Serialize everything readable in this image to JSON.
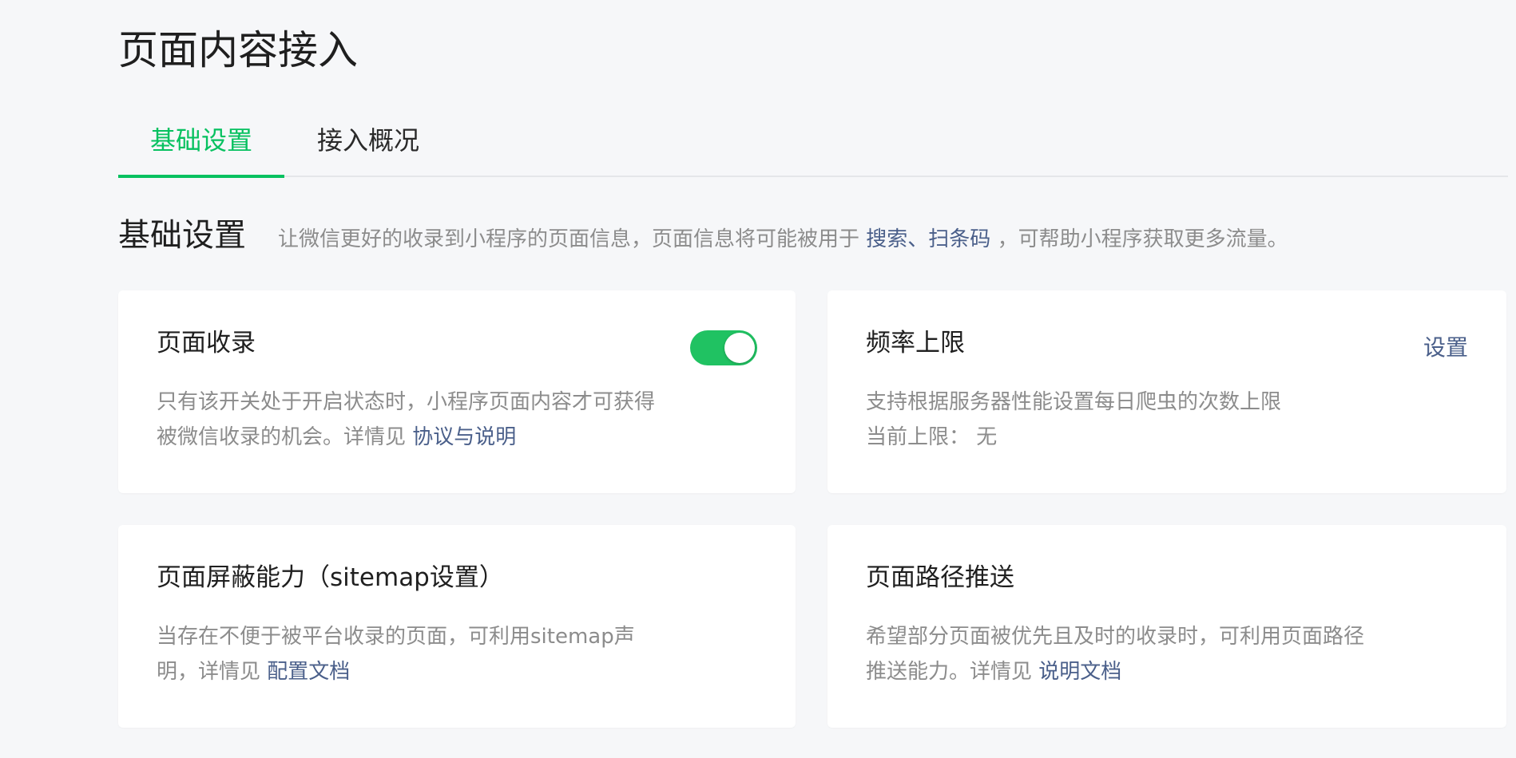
{
  "page": {
    "title": "页面内容接入"
  },
  "tabs": [
    {
      "label": "基础设置",
      "active": true
    },
    {
      "label": "接入概况",
      "active": false
    }
  ],
  "section": {
    "title": "基础设置",
    "desc_prefix": "让微信更好的收录到小程序的页面信息，页面信息将可能被用于",
    "desc_link": "搜索、扫条码",
    "desc_suffix": "，可帮助小程序获取更多流量。"
  },
  "cards": {
    "page_index": {
      "title": "页面收录",
      "toggle_on": true,
      "desc_line1": "只有该开关处于开启状态时，小程序页面内容才可获得",
      "desc_line2": "被微信收录的机会。详情见",
      "link": "协议与说明"
    },
    "rate_limit": {
      "title": "频率上限",
      "action": "设置",
      "desc_line1": "支持根据服务器性能设置每日爬虫的次数上限",
      "limit_label": "当前上限：",
      "limit_value": "无"
    },
    "sitemap": {
      "title": "页面屏蔽能力（sitemap设置）",
      "desc_line1": "当存在不便于被平台收录的页面，可利用sitemap声",
      "desc_line2": "明，详情见",
      "link": "配置文档"
    },
    "path_push": {
      "title": "页面路径推送",
      "desc_line1": "希望部分页面被优先且及时的收录时，可利用页面路径",
      "desc_line2": "推送能力。详情见",
      "link": "说明文档"
    }
  },
  "colors": {
    "accent": "#07c160",
    "toggle": "#20c262",
    "link": "#4a5f8a",
    "background": "#f6f7f9",
    "muted_text": "#8c8c8c"
  }
}
